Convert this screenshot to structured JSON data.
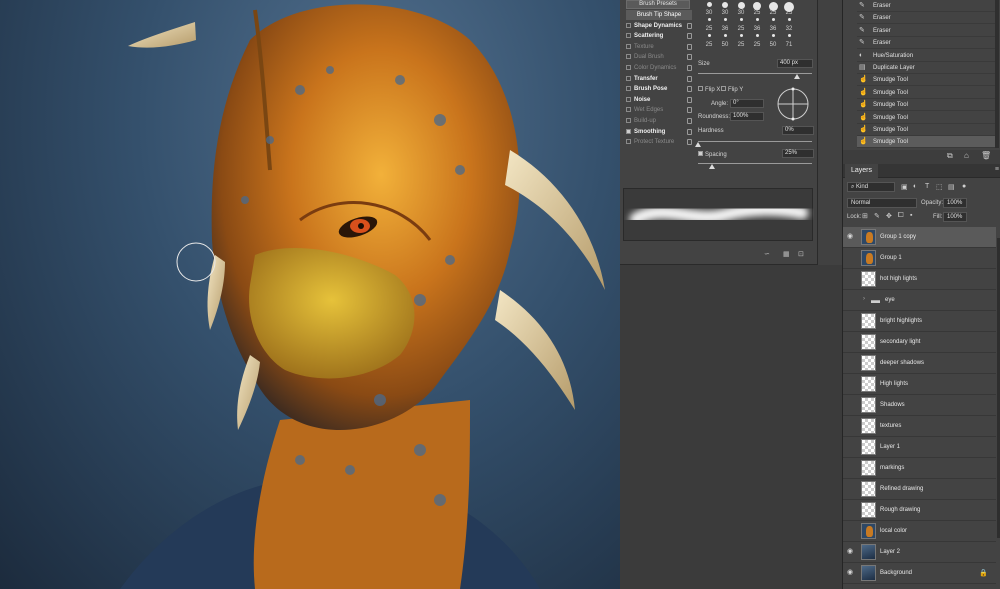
{
  "brush_panel": {
    "presets_button": "Brush Presets",
    "options": [
      {
        "label": "Brush Tip Shape",
        "state": "selected",
        "checkbox": false
      },
      {
        "label": "Shape Dynamics",
        "state": "bold",
        "checkbox": true,
        "checked": false
      },
      {
        "label": "Scattering",
        "state": "bold",
        "checkbox": true,
        "checked": false
      },
      {
        "label": "Texture",
        "state": "dim",
        "checkbox": true,
        "checked": false
      },
      {
        "label": "Dual Brush",
        "state": "dim",
        "checkbox": true,
        "checked": false
      },
      {
        "label": "Color Dynamics",
        "state": "dim",
        "checkbox": true,
        "checked": false
      },
      {
        "label": "Transfer",
        "state": "bold",
        "checkbox": true,
        "checked": false
      },
      {
        "label": "Brush Pose",
        "state": "bold",
        "checkbox": true,
        "checked": false
      },
      {
        "label": "Noise",
        "state": "bold",
        "checkbox": true,
        "checked": false
      },
      {
        "label": "Wet Edges",
        "state": "dim",
        "checkbox": true,
        "checked": false
      },
      {
        "label": "Build-up",
        "state": "dim",
        "checkbox": true,
        "checked": false
      },
      {
        "label": "Smoothing",
        "state": "bold",
        "checkbox": true,
        "checked": true
      },
      {
        "label": "Protect Texture",
        "state": "dim",
        "checkbox": true,
        "checked": false
      }
    ],
    "tip_sizes": [
      [
        "30",
        "30",
        "30",
        "25",
        "25",
        "25"
      ],
      [
        "25",
        "36",
        "25",
        "36",
        "36",
        "32"
      ],
      [
        "25",
        "50",
        "25",
        "25",
        "50",
        "71"
      ]
    ],
    "size_label": "Size",
    "size_value": "400 px",
    "flip_x": "Flip X",
    "flip_y": "Flip Y",
    "angle_label": "Angle:",
    "angle_value": "0°",
    "roundness_label": "Roundness:",
    "roundness_value": "100%",
    "hardness_label": "Hardness",
    "hardness_value": "0%",
    "spacing_label": "Spacing",
    "spacing_value": "25%",
    "spacing_checked": true
  },
  "history": {
    "items": [
      {
        "label": "Eraser",
        "icon": "eraser-icon"
      },
      {
        "label": "Eraser",
        "icon": "eraser-icon"
      },
      {
        "label": "Eraser",
        "icon": "eraser-icon"
      },
      {
        "label": "Eraser",
        "icon": "eraser-icon"
      },
      {
        "label": "Hue/Saturation",
        "icon": "adjustment-icon"
      },
      {
        "label": "Duplicate Layer",
        "icon": "layer-icon"
      },
      {
        "label": "Smudge Tool",
        "icon": "smudge-icon"
      },
      {
        "label": "Smudge Tool",
        "icon": "smudge-icon"
      },
      {
        "label": "Smudge Tool",
        "icon": "smudge-icon"
      },
      {
        "label": "Smudge Tool",
        "icon": "smudge-icon"
      },
      {
        "label": "Smudge Tool",
        "icon": "smudge-icon"
      },
      {
        "label": "Smudge Tool",
        "icon": "smudge-icon",
        "selected": true
      }
    ]
  },
  "layers_panel": {
    "tab_label": "Layers",
    "filter_kind": "Kind",
    "blend_mode": "Normal",
    "opacity_label": "Opacity:",
    "opacity_value": "100%",
    "lock_label": "Lock:",
    "fill_label": "Fill:",
    "fill_value": "100%",
    "layers": [
      {
        "name": "Group 1 copy",
        "visible": true,
        "thumb": "face",
        "selected": true
      },
      {
        "name": "Group 1",
        "visible": false,
        "thumb": "face"
      },
      {
        "name": "hot high lights",
        "visible": false,
        "thumb": "transparent"
      },
      {
        "name": "eye",
        "visible": false,
        "thumb": "folder"
      },
      {
        "name": "bright highlights",
        "visible": false,
        "thumb": "transparent"
      },
      {
        "name": "secondary light",
        "visible": false,
        "thumb": "transparent"
      },
      {
        "name": "deeper shadows",
        "visible": false,
        "thumb": "transparent"
      },
      {
        "name": "High lights",
        "visible": false,
        "thumb": "transparent"
      },
      {
        "name": "Shadows",
        "visible": false,
        "thumb": "transparent"
      },
      {
        "name": "textures",
        "visible": false,
        "thumb": "transparent"
      },
      {
        "name": "Layer 1",
        "visible": false,
        "thumb": "transparent"
      },
      {
        "name": "markings",
        "visible": false,
        "thumb": "transparent"
      },
      {
        "name": "Refined drawing",
        "visible": false,
        "thumb": "transparent"
      },
      {
        "name": "Rough drawing",
        "visible": false,
        "thumb": "transparent"
      },
      {
        "name": "local color",
        "visible": false,
        "thumb": "face"
      },
      {
        "name": "Layer 2",
        "visible": true,
        "thumb": "blue"
      },
      {
        "name": "Background",
        "visible": true,
        "thumb": "blue",
        "locked": true
      }
    ]
  }
}
